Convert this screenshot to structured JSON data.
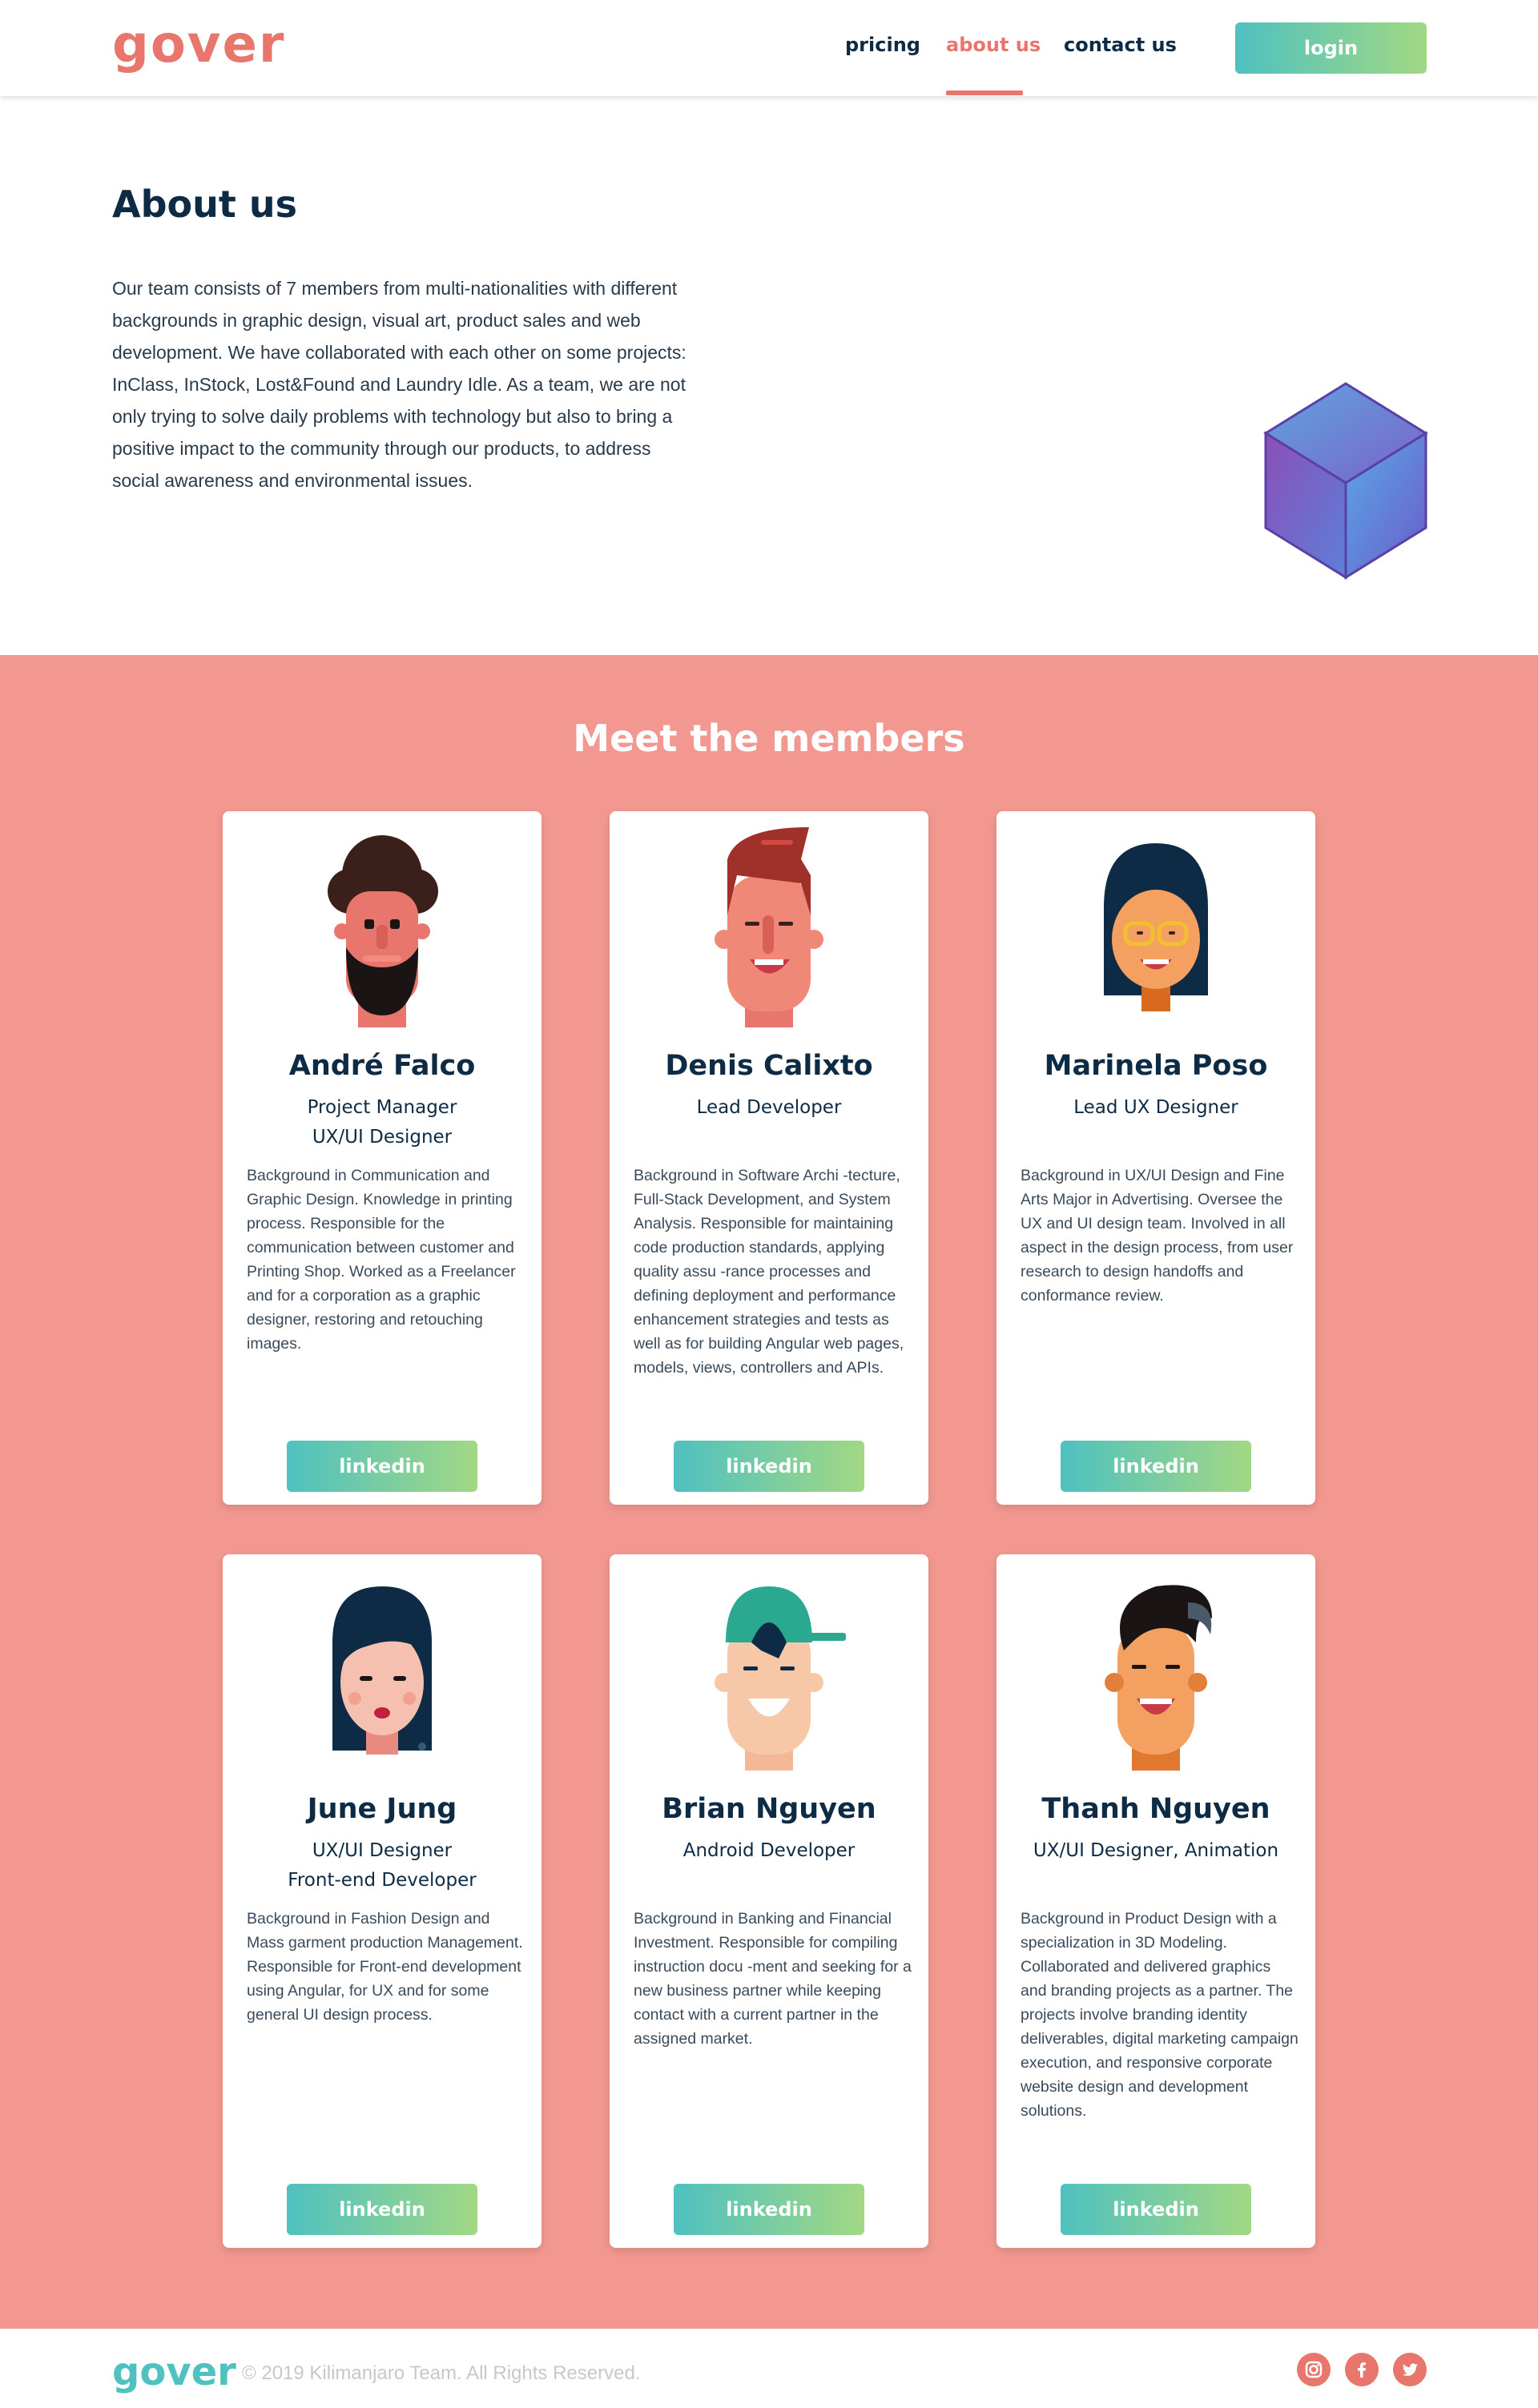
{
  "header": {
    "logo": "gover",
    "nav": [
      {
        "label": "pricing"
      },
      {
        "label": "about us",
        "active": true
      },
      {
        "label": "contact us"
      }
    ],
    "login_label": "login"
  },
  "about": {
    "title": "About us",
    "text": "Our team consists of 7 members from multi-nationalities with different backgrounds in graphic design, visual art, product sales and web development. We have collaborated with each other on some projects: InClass, InStock, Lost&Found and Laundry Idle. As a team, we are not only trying to solve daily problems with technology but also to bring a positive impact to the community through our products, to address social awareness and environmental issues."
  },
  "members_title": "Meet the members",
  "members": [
    {
      "name": "André Falco",
      "role": "Project Manager\nUX/UI Designer",
      "bio": "Background in Communication and Graphic Design. Knowledge in printing process. Responsible for the communication between customer and Printing Shop. Worked as a Freelancer and for a corporation as a graphic designer, restoring and retouching images.",
      "link_label": "linkedin",
      "avatar": "bearded-man-avatar"
    },
    {
      "name": "Denis Calixto",
      "role": "Lead Developer",
      "bio": "Background in Software Archi -tecture, Full-Stack Development, and System Analysis. Responsible for maintaining code production standards, applying quality assu -rance processes and defining deployment and performance enhancement strategies and tests as well as for building Angular web pages, models, views, controllers and APIs.",
      "link_label": "linkedin",
      "avatar": "redhead-man-avatar"
    },
    {
      "name": "Marinela Poso",
      "role": "Lead UX Designer",
      "bio": "Background in UX/UI Design and Fine Arts Major in Advertising. Oversee the UX and UI design team. Involved in all aspect in the design process, from user research to design handoffs and conformance review.",
      "link_label": "linkedin",
      "avatar": "woman-glasses-avatar"
    },
    {
      "name": "June Jung",
      "role": "UX/UI Designer\nFront-end Developer",
      "bio": "Background in Fashion Design and Mass garment production Management. Responsible for Front-end development using Angular, for UX and for some general UI design process.",
      "link_label": "linkedin",
      "avatar": "woman-long-hair-avatar"
    },
    {
      "name": "Brian Nguyen",
      "role": "Android Developer",
      "bio": "Background in Banking and Financial Investment. Responsible for compiling instruction docu -ment and seeking for a new business partner while keeping contact with a current partner in the assigned market.",
      "link_label": "linkedin",
      "avatar": "man-cap-avatar"
    },
    {
      "name": "Thanh Nguyen",
      "role": "UX/UI Designer, Animation",
      "bio": "Background in Product Design with a specialization in 3D Modeling.\nCollaborated and delivered graphics and branding projects as a partner. The projects involve branding identity deliverables, digital marketing campaign execution, and responsive corporate website design and development solutions.",
      "link_label": "linkedin",
      "avatar": "man-quiff-avatar"
    }
  ],
  "footer": {
    "logo": "gover",
    "copyright": "© 2019 Kilimanjaro Team. All Rights Reserved.",
    "social": [
      "instagram-icon",
      "facebook-icon",
      "twitter-icon"
    ]
  },
  "colors": {
    "accent": "#e8766c",
    "members_bg": "#f29890",
    "gradient_start": "#4fc1c0",
    "gradient_end": "#a2d884",
    "text_dark": "#0d2b45"
  }
}
